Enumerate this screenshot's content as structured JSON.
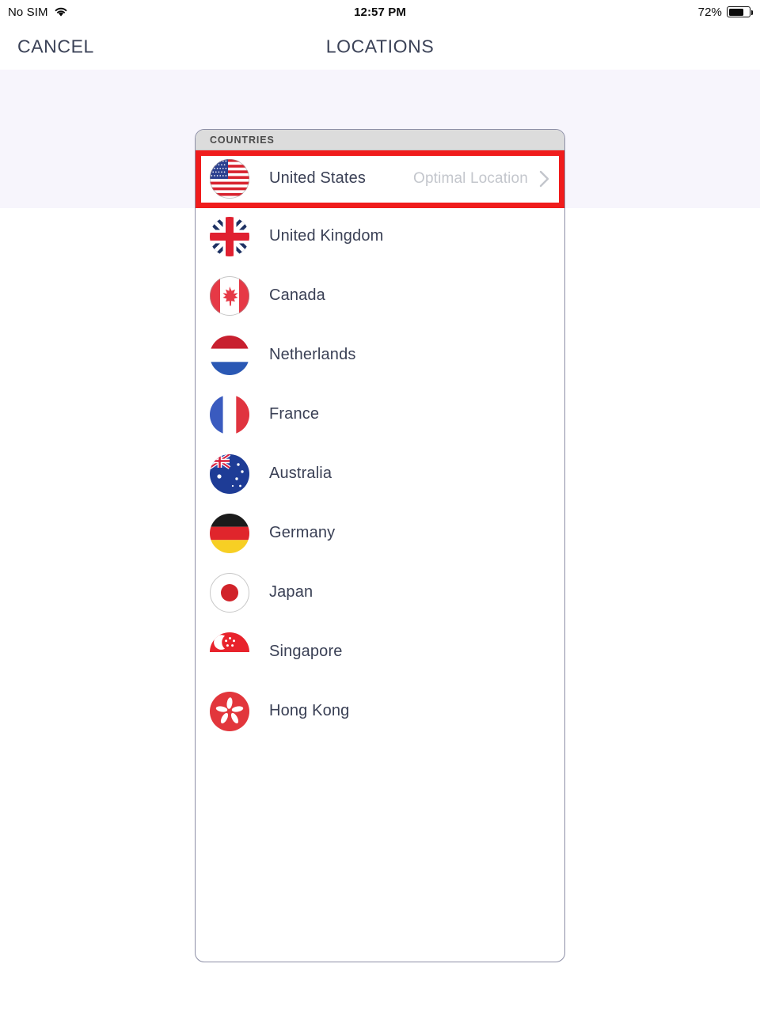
{
  "status_bar": {
    "carrier": "No SIM",
    "wifi_icon": "wifi-icon",
    "time": "12:57 PM",
    "battery_percent": "72%",
    "battery_level": 72
  },
  "nav": {
    "cancel_label": "CANCEL",
    "title": "LOCATIONS"
  },
  "panel": {
    "section_header": "COUNTRIES",
    "rows": [
      {
        "name": "United States",
        "flag": "flag-us",
        "detail": "Optimal Location",
        "chevron": "chevron-right-icon",
        "selected": true
      },
      {
        "name": "United Kingdom",
        "flag": "flag-gb",
        "detail": "",
        "chevron": "",
        "selected": false
      },
      {
        "name": "Canada",
        "flag": "flag-ca",
        "detail": "",
        "chevron": "",
        "selected": false
      },
      {
        "name": "Netherlands",
        "flag": "flag-nl",
        "detail": "",
        "chevron": "",
        "selected": false
      },
      {
        "name": "France",
        "flag": "flag-fr",
        "detail": "",
        "chevron": "",
        "selected": false
      },
      {
        "name": "Australia",
        "flag": "flag-au",
        "detail": "",
        "chevron": "",
        "selected": false
      },
      {
        "name": "Germany",
        "flag": "flag-de",
        "detail": "",
        "chevron": "",
        "selected": false
      },
      {
        "name": "Japan",
        "flag": "flag-jp",
        "detail": "",
        "chevron": "",
        "selected": false
      },
      {
        "name": "Singapore",
        "flag": "flag-sg",
        "detail": "",
        "chevron": "",
        "selected": false
      },
      {
        "name": "Hong Kong",
        "flag": "flag-hk",
        "detail": "",
        "chevron": "",
        "selected": false
      }
    ]
  },
  "annotation": {
    "highlight_color": "#f01c1c",
    "highlight_target": "United States"
  },
  "colors": {
    "tint_band": "#f7f5fc",
    "text_primary": "#3a4055",
    "text_muted": "#c3c6cc",
    "panel_border": "#8d8fa6",
    "section_header_bg": "#dcdcdc"
  }
}
